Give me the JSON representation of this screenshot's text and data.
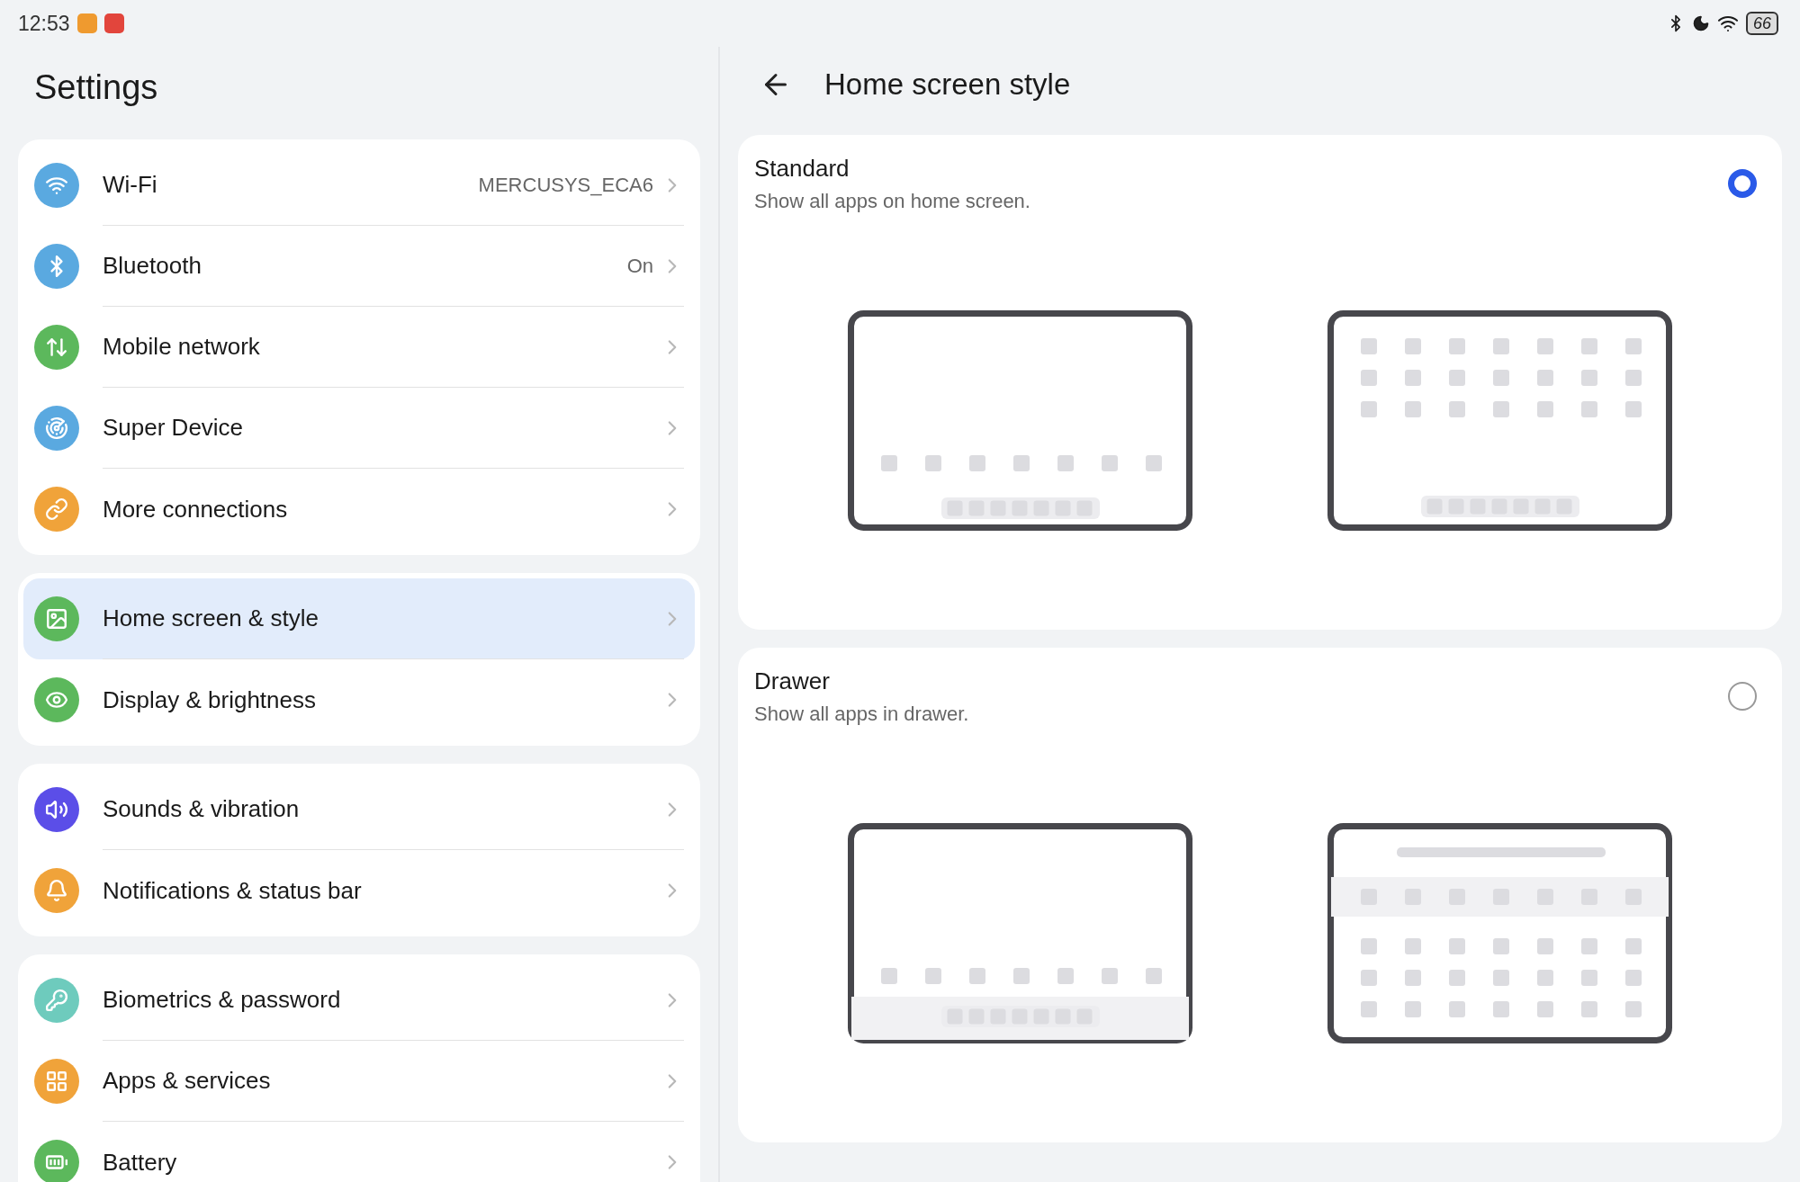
{
  "status_bar": {
    "time": "12:53",
    "battery": "66"
  },
  "sidebar": {
    "title": "Settings",
    "groups": [
      {
        "items": [
          {
            "label": "Wi-Fi",
            "value": "MERCUSYS_ECA6",
            "color": "#5aa9e0",
            "selected": false
          },
          {
            "label": "Bluetooth",
            "value": "On",
            "color": "#5aa9e0",
            "selected": false
          },
          {
            "label": "Mobile network",
            "color": "#5cb85c",
            "selected": false
          },
          {
            "label": "Super Device",
            "color": "#5aa9e0",
            "selected": false
          },
          {
            "label": "More connections",
            "color": "#f0a33a",
            "selected": false
          }
        ]
      },
      {
        "items": [
          {
            "label": "Home screen & style",
            "color": "#5cb85c",
            "selected": true
          },
          {
            "label": "Display & brightness",
            "color": "#5cb85c",
            "selected": false
          }
        ]
      },
      {
        "items": [
          {
            "label": "Sounds & vibration",
            "color": "#5b4ee8",
            "selected": false
          },
          {
            "label": "Notifications & status bar",
            "color": "#f0a33a",
            "selected": false
          }
        ]
      },
      {
        "items": [
          {
            "label": "Biometrics & password",
            "color": "#6ecbbd",
            "selected": false
          },
          {
            "label": "Apps & services",
            "color": "#f0a33a",
            "selected": false
          },
          {
            "label": "Battery",
            "color": "#5cb85c",
            "selected": false
          }
        ]
      }
    ]
  },
  "detail": {
    "title": "Home screen style",
    "options": [
      {
        "kind": "standard",
        "title": "Standard",
        "description": "Show all apps on home screen.",
        "selected": true
      },
      {
        "kind": "drawer",
        "title": "Drawer",
        "description": "Show all apps in drawer.",
        "selected": false
      }
    ]
  }
}
